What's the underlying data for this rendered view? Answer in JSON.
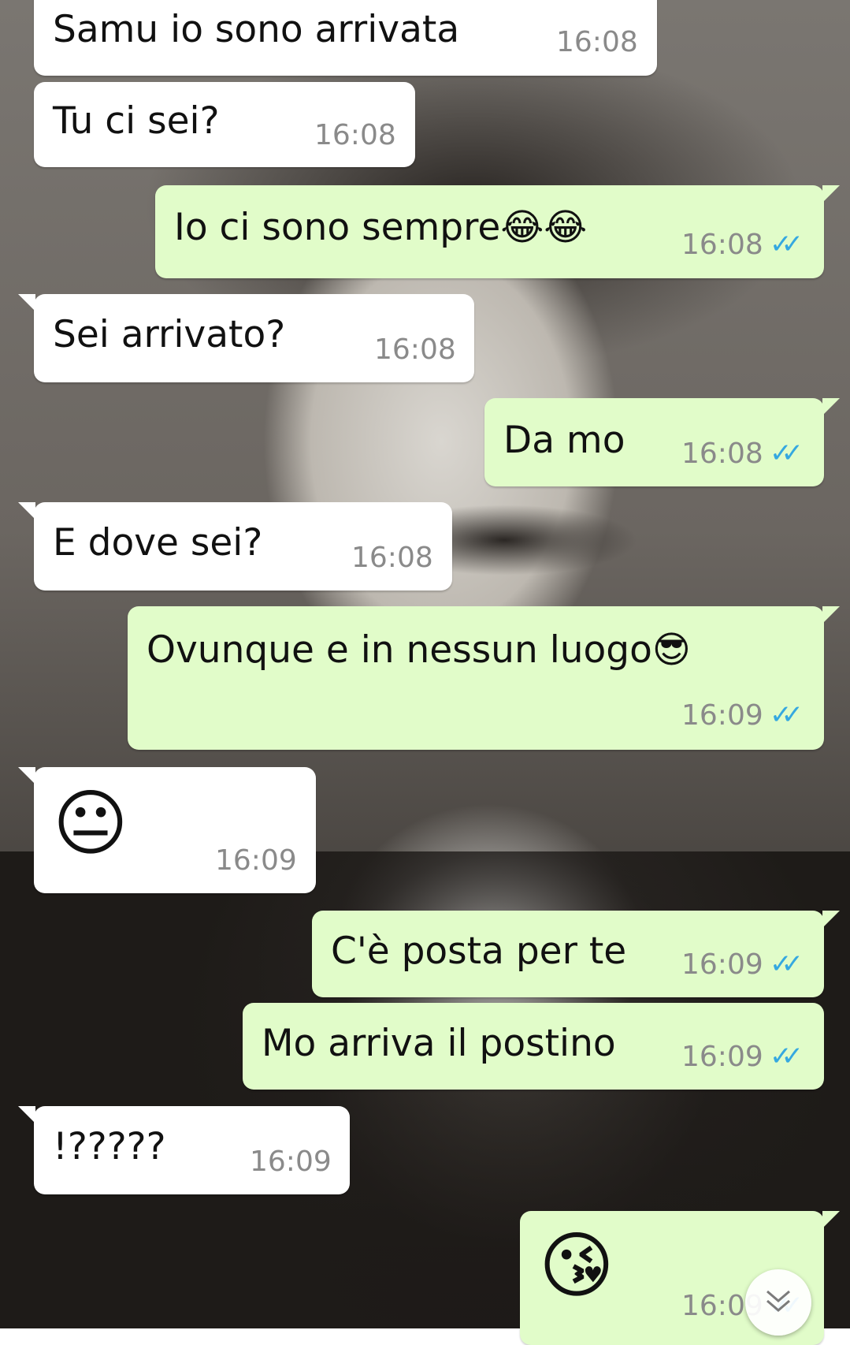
{
  "messages": [
    {
      "text": "Samu io sono arrivata",
      "time": "16:08"
    },
    {
      "text": "Tu ci sei?",
      "time": "16:08"
    },
    {
      "text": "Io ci sono sempre😂😂",
      "time": "16:08"
    },
    {
      "text": "Sei arrivato?",
      "time": "16:08"
    },
    {
      "text": "Da mo",
      "time": "16:08"
    },
    {
      "text": "E dove sei?",
      "time": "16:08"
    },
    {
      "text": "Ovunque e in nessun luogo😎",
      "time": "16:09"
    },
    {
      "text": "😐",
      "time": "16:09"
    },
    {
      "text": "C'è posta per te",
      "time": "16:09"
    },
    {
      "text": "Mo arriva il postino",
      "time": "16:09"
    },
    {
      "text": "!?????",
      "time": "16:09"
    },
    {
      "text": "😘",
      "time": "16:09"
    }
  ],
  "read_ticks": "✓✓",
  "colors": {
    "incoming": "#ffffff",
    "outgoing": "#e1fcc9",
    "tick": "#35a8e0",
    "time": "#8a8a8a"
  }
}
